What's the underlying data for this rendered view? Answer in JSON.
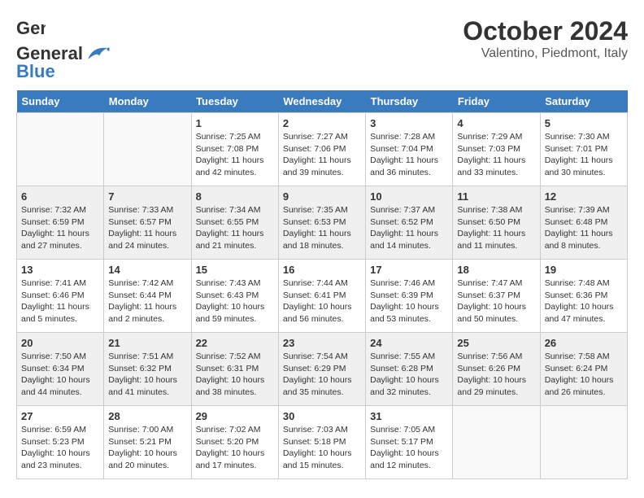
{
  "header": {
    "logo_general": "General",
    "logo_blue": "Blue",
    "month": "October 2024",
    "location": "Valentino, Piedmont, Italy"
  },
  "days_of_week": [
    "Sunday",
    "Monday",
    "Tuesday",
    "Wednesday",
    "Thursday",
    "Friday",
    "Saturday"
  ],
  "weeks": [
    [
      {
        "day": "",
        "content": ""
      },
      {
        "day": "",
        "content": ""
      },
      {
        "day": "1",
        "content": "Sunrise: 7:25 AM\nSunset: 7:08 PM\nDaylight: 11 hours and 42 minutes."
      },
      {
        "day": "2",
        "content": "Sunrise: 7:27 AM\nSunset: 7:06 PM\nDaylight: 11 hours and 39 minutes."
      },
      {
        "day": "3",
        "content": "Sunrise: 7:28 AM\nSunset: 7:04 PM\nDaylight: 11 hours and 36 minutes."
      },
      {
        "day": "4",
        "content": "Sunrise: 7:29 AM\nSunset: 7:03 PM\nDaylight: 11 hours and 33 minutes."
      },
      {
        "day": "5",
        "content": "Sunrise: 7:30 AM\nSunset: 7:01 PM\nDaylight: 11 hours and 30 minutes."
      }
    ],
    [
      {
        "day": "6",
        "content": "Sunrise: 7:32 AM\nSunset: 6:59 PM\nDaylight: 11 hours and 27 minutes."
      },
      {
        "day": "7",
        "content": "Sunrise: 7:33 AM\nSunset: 6:57 PM\nDaylight: 11 hours and 24 minutes."
      },
      {
        "day": "8",
        "content": "Sunrise: 7:34 AM\nSunset: 6:55 PM\nDaylight: 11 hours and 21 minutes."
      },
      {
        "day": "9",
        "content": "Sunrise: 7:35 AM\nSunset: 6:53 PM\nDaylight: 11 hours and 18 minutes."
      },
      {
        "day": "10",
        "content": "Sunrise: 7:37 AM\nSunset: 6:52 PM\nDaylight: 11 hours and 14 minutes."
      },
      {
        "day": "11",
        "content": "Sunrise: 7:38 AM\nSunset: 6:50 PM\nDaylight: 11 hours and 11 minutes."
      },
      {
        "day": "12",
        "content": "Sunrise: 7:39 AM\nSunset: 6:48 PM\nDaylight: 11 hours and 8 minutes."
      }
    ],
    [
      {
        "day": "13",
        "content": "Sunrise: 7:41 AM\nSunset: 6:46 PM\nDaylight: 11 hours and 5 minutes."
      },
      {
        "day": "14",
        "content": "Sunrise: 7:42 AM\nSunset: 6:44 PM\nDaylight: 11 hours and 2 minutes."
      },
      {
        "day": "15",
        "content": "Sunrise: 7:43 AM\nSunset: 6:43 PM\nDaylight: 10 hours and 59 minutes."
      },
      {
        "day": "16",
        "content": "Sunrise: 7:44 AM\nSunset: 6:41 PM\nDaylight: 10 hours and 56 minutes."
      },
      {
        "day": "17",
        "content": "Sunrise: 7:46 AM\nSunset: 6:39 PM\nDaylight: 10 hours and 53 minutes."
      },
      {
        "day": "18",
        "content": "Sunrise: 7:47 AM\nSunset: 6:37 PM\nDaylight: 10 hours and 50 minutes."
      },
      {
        "day": "19",
        "content": "Sunrise: 7:48 AM\nSunset: 6:36 PM\nDaylight: 10 hours and 47 minutes."
      }
    ],
    [
      {
        "day": "20",
        "content": "Sunrise: 7:50 AM\nSunset: 6:34 PM\nDaylight: 10 hours and 44 minutes."
      },
      {
        "day": "21",
        "content": "Sunrise: 7:51 AM\nSunset: 6:32 PM\nDaylight: 10 hours and 41 minutes."
      },
      {
        "day": "22",
        "content": "Sunrise: 7:52 AM\nSunset: 6:31 PM\nDaylight: 10 hours and 38 minutes."
      },
      {
        "day": "23",
        "content": "Sunrise: 7:54 AM\nSunset: 6:29 PM\nDaylight: 10 hours and 35 minutes."
      },
      {
        "day": "24",
        "content": "Sunrise: 7:55 AM\nSunset: 6:28 PM\nDaylight: 10 hours and 32 minutes."
      },
      {
        "day": "25",
        "content": "Sunrise: 7:56 AM\nSunset: 6:26 PM\nDaylight: 10 hours and 29 minutes."
      },
      {
        "day": "26",
        "content": "Sunrise: 7:58 AM\nSunset: 6:24 PM\nDaylight: 10 hours and 26 minutes."
      }
    ],
    [
      {
        "day": "27",
        "content": "Sunrise: 6:59 AM\nSunset: 5:23 PM\nDaylight: 10 hours and 23 minutes."
      },
      {
        "day": "28",
        "content": "Sunrise: 7:00 AM\nSunset: 5:21 PM\nDaylight: 10 hours and 20 minutes."
      },
      {
        "day": "29",
        "content": "Sunrise: 7:02 AM\nSunset: 5:20 PM\nDaylight: 10 hours and 17 minutes."
      },
      {
        "day": "30",
        "content": "Sunrise: 7:03 AM\nSunset: 5:18 PM\nDaylight: 10 hours and 15 minutes."
      },
      {
        "day": "31",
        "content": "Sunrise: 7:05 AM\nSunset: 5:17 PM\nDaylight: 10 hours and 12 minutes."
      },
      {
        "day": "",
        "content": ""
      },
      {
        "day": "",
        "content": ""
      }
    ]
  ]
}
